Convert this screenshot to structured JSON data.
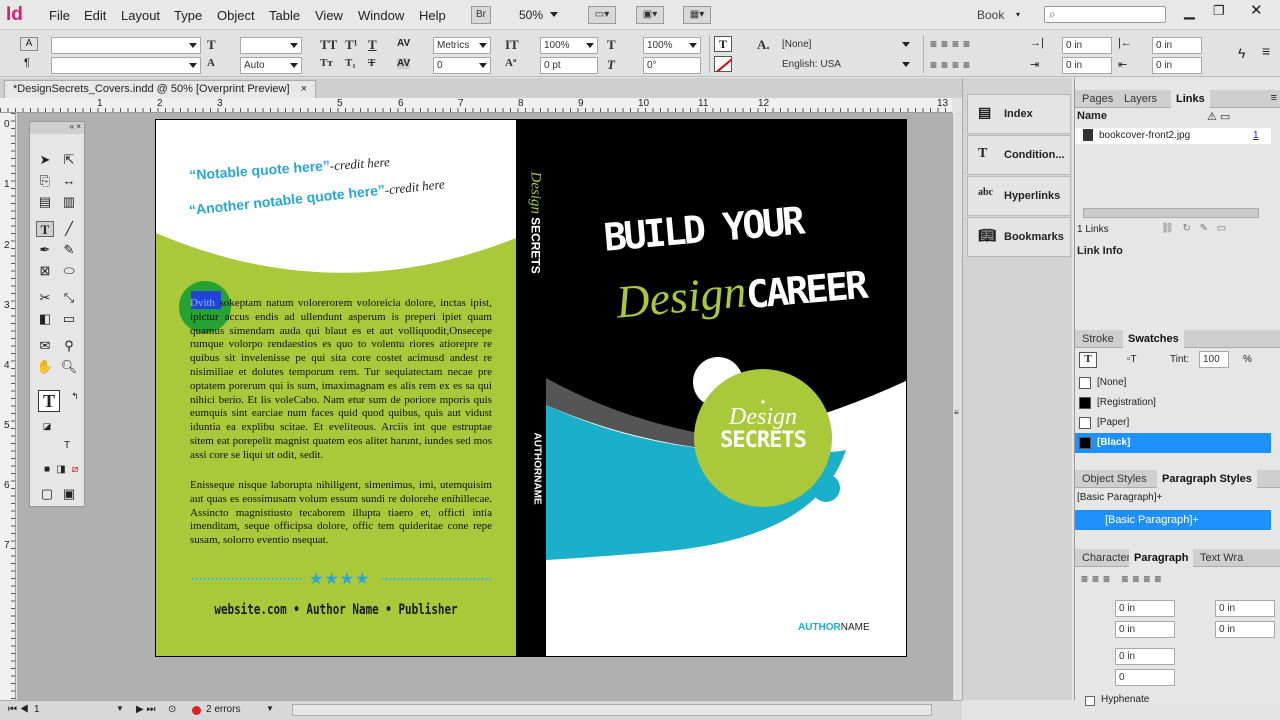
{
  "app": {
    "logo": "Id"
  },
  "menu": [
    "File",
    "Edit",
    "Layout",
    "Type",
    "Object",
    "Table",
    "View",
    "Window",
    "Help"
  ],
  "menubar_extras": {
    "br": "Br",
    "zoom": "50%",
    "workspace": "Book",
    "search_placeholder": ""
  },
  "control": {
    "font_family": "",
    "font_style": "",
    "font_size": "",
    "leading": "Auto",
    "kerning": "Metrics",
    "tracking": "0",
    "vscale": "100%",
    "hscale": "100%",
    "baseline": "0 pt",
    "skew": "0°",
    "char_style": "[None]",
    "language": "English: USA",
    "left_indent": "0 in",
    "right_indent": "0 in",
    "first_indent": "0 in",
    "last_indent": "0 in"
  },
  "doc_tab": {
    "title": "*DesignSecrets_Covers.indd @ 50% [Overprint Preview]",
    "close": "×"
  },
  "ruler": {
    "h_ticks": [
      "1",
      "2",
      "3",
      "4",
      "5",
      "6",
      "7",
      "8",
      "9",
      "10",
      "11",
      "12",
      "13"
    ],
    "v_ticks": [
      "0",
      "1",
      "2",
      "3",
      "4",
      "5",
      "6",
      "7"
    ]
  },
  "cover": {
    "quote1": "“Notable quote here”",
    "credit1": "-credit here",
    "quote2": "“Another notable quote here”",
    "credit2": "-credit here",
    "selected_word": "Dvith",
    "para1_rest": "sokeptam natum volorerorem voloreicia dolore, inctas ipist, ipictur accus endis ad ullendunt asperum is preperi ipiet quam quamus simendam auda qui blaut es et aut volliquodit,Onsecepe rumque volorpo rendaestios es quo to volentu riores atiorepre re quibus sit invelenisse pe qui sita core costet acimusd andest re nisimiliae et dolutes temporum rem. Tur sequiatectam necae pre optatem porerum qui is sum, imaximagnam es alis rem ex es sa qui nihici berio. Et lis voleCabo. Nam etur sum de poriore mporis quis eumquis sint earciae num faces quid quod quibus, quis aut vidust iduntia ea explibu scitae. Et eveliteous. Arciis int que estruptae sitem eat porepelit magnist quatem eos alitet harunt, iundes sed mos assi core se liqui ut odit, sedit.",
    "para2": "Enisseque nisque laborupta nihiligent, simenimus, imi, utemquisim aut quas es eossimusam volum essum sundi re dolorehe enihillecae. Assincto magnistiusto tecaborem illupta tiaero et, officti intia imenditam, seque officipsa dolore, offic tem quideritae cone repe susam, solorro eventio nsequat.",
    "stars": "★★★★",
    "footer": "website.com • Author Name • Publisher",
    "spine_title_script": "Design",
    "spine_title_caps": "SECRETS",
    "spine_author": "AUTHORNAME",
    "headline1": "BUILD YOUR",
    "headline_script": "Design",
    "headline2": "CAREER",
    "badge_script": "Design",
    "badge_caps": "SECRETS",
    "badge_star": "★",
    "author_first": "AUTHOR",
    "author_last": "NAME",
    "colors": {
      "lime": "#a9c83a",
      "cyan": "#1ab0c9",
      "black": "#000000",
      "blue": "#28a6d8"
    }
  },
  "dock": [
    "Index",
    "Condition...",
    "Hyperlinks",
    "Bookmarks"
  ],
  "links_panel": {
    "tabs": [
      "Pages",
      "Layers",
      "Links"
    ],
    "col_name": "Name",
    "file": "bookcover-front2.jpg",
    "page": "1",
    "count": "1 Links",
    "info": "Link Info"
  },
  "swatches_panel": {
    "tabs": [
      "Stroke",
      "Swatches"
    ],
    "tint_label": "Tint:",
    "tint": "100",
    "tint_unit": "%",
    "items": [
      "[None]",
      "[Registration]",
      "[Paper]",
      "[Black]"
    ]
  },
  "styles_panel": {
    "tabs": [
      "Object Styles",
      "Paragraph Styles"
    ],
    "current": "[Basic Paragraph]+",
    "item": "[Basic Paragraph]+"
  },
  "para_panel": {
    "tabs": [
      "Character",
      "Paragraph",
      "Text Wra"
    ],
    "fields": [
      "0 in",
      "0 in",
      "0 in",
      "0 in",
      "0 in",
      "0"
    ],
    "hyphenate": "Hyphenate"
  },
  "status": {
    "page": "1",
    "errors": "2 errors"
  }
}
